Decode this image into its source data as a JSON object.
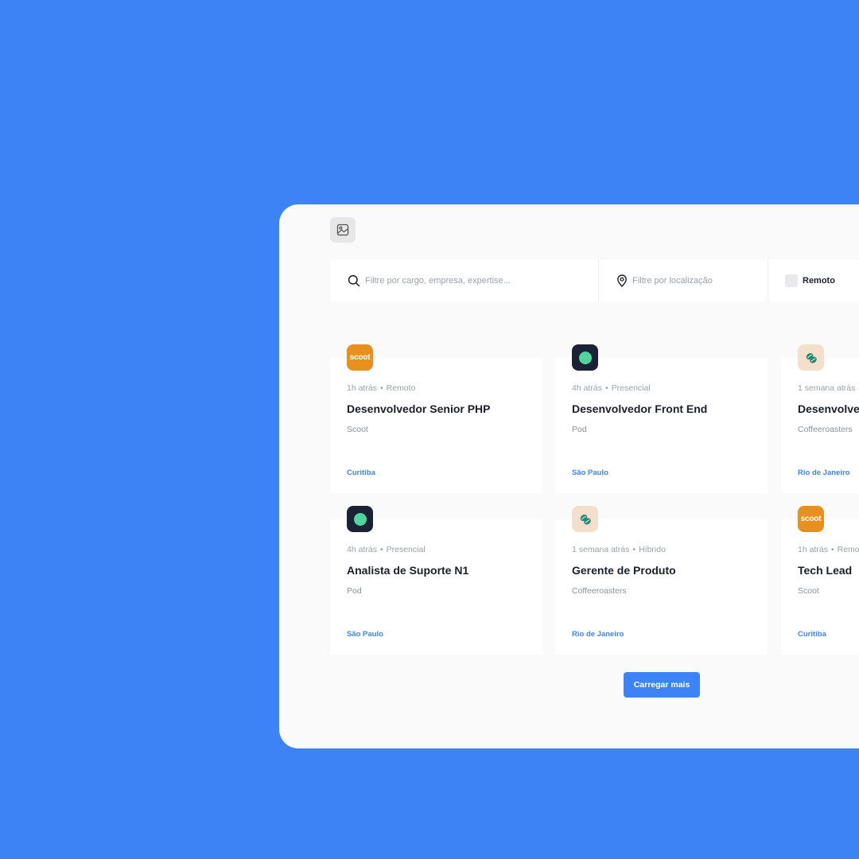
{
  "filters": {
    "search_placeholder": "Filtre por cargo, empresa, expertise...",
    "location_placeholder": "Filtre por localização",
    "remote_label": "Remoto"
  },
  "jobs": [
    {
      "logo": "scoot",
      "logo_text": "scoot",
      "time": "1h atrás",
      "type": "Remoto",
      "title": "Desenvolvedor Senior PHP",
      "company": "Scoot",
      "location": "Curitiba"
    },
    {
      "logo": "pod",
      "time": "4h atrás",
      "type": "Presencial",
      "title": "Desenvolvedor Front End",
      "company": "Pod",
      "location": "São Paulo"
    },
    {
      "logo": "coffeeroasters",
      "time": "1 semana atrás",
      "type": "",
      "title": "Desenvolvedor",
      "company": "Coffeeroasters",
      "location": "Rio de Janeiro"
    },
    {
      "logo": "pod",
      "time": "4h atrás",
      "type": "Presencial",
      "title": "Analista de Suporte N1",
      "company": "Pod",
      "location": "São Paulo"
    },
    {
      "logo": "coffeeroasters",
      "time": "1 semana atrás",
      "type": "Híbrido",
      "title": "Gerente de Produto",
      "company": "Coffeeroasters",
      "location": "Rio de Janeiro"
    },
    {
      "logo": "scoot",
      "logo_text": "scoot",
      "time": "1h atrás",
      "type": "Remoto",
      "title": "Tech Lead",
      "company": "Scoot",
      "location": "Curitiba"
    }
  ],
  "load_more_label": "Carregar mais",
  "colors": {
    "background": "#3d83f5",
    "accent": "#3d83f5",
    "scoot": "#e8901b",
    "pod": "#1b2236",
    "pod_dot": "#4fd69c",
    "coffeeroasters": "#f4dfcd"
  },
  "icons": [
    "image-icon",
    "search-icon",
    "location-pin-icon",
    "coffee-bean-icon"
  ]
}
